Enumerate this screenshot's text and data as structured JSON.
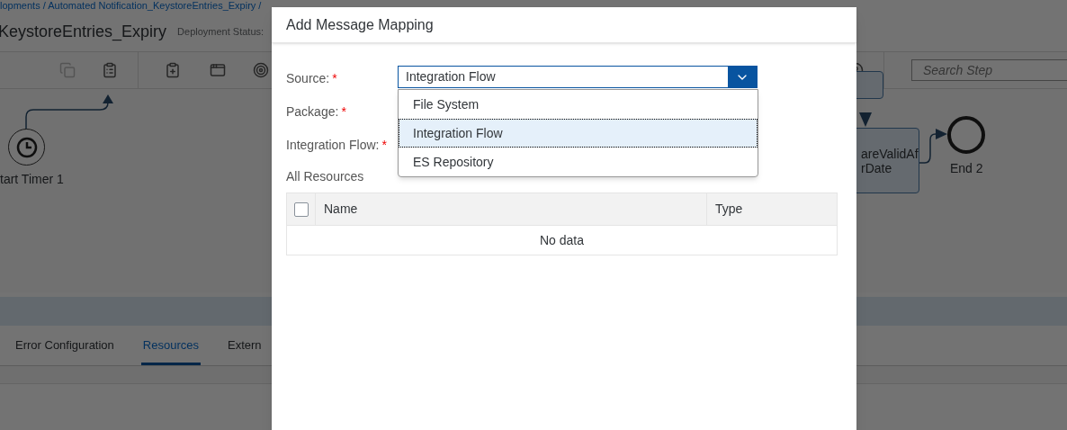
{
  "background": {
    "breadcrumb": "lopments / Automated Notification_KeystoreEntries_Expiry /",
    "title": "KeystoreEntries_Expiry",
    "deployment_status": "Deployment Status:",
    "search": {
      "placeholder": "Search Step"
    },
    "canvas": {
      "start_event": "tart Timer 1",
      "step_lines": [
        "areValidAf",
        "rDate"
      ],
      "end_event": "End 2"
    },
    "tabs": [
      {
        "label": "Error Configuration",
        "selected": false
      },
      {
        "label": "Resources",
        "selected": true
      },
      {
        "label": "Extern",
        "selected": false
      }
    ]
  },
  "dialog": {
    "title": "Add Message Mapping",
    "fields": [
      {
        "label": "Source:",
        "required_mark": "*"
      },
      {
        "label": "Package:",
        "required_mark": "*"
      },
      {
        "label": "Integration Flow:",
        "required_mark": "*"
      }
    ],
    "source_select": {
      "value": "Integration Flow",
      "expanded": true,
      "options": [
        {
          "label": "File System",
          "selected": false
        },
        {
          "label": "Integration Flow",
          "selected": true
        },
        {
          "label": "ES Repository",
          "selected": false
        }
      ]
    },
    "resources": {
      "title": "All Resources",
      "select_all_checked": false,
      "columns": [
        "Name",
        "Type"
      ],
      "empty_text": "No data"
    }
  }
}
